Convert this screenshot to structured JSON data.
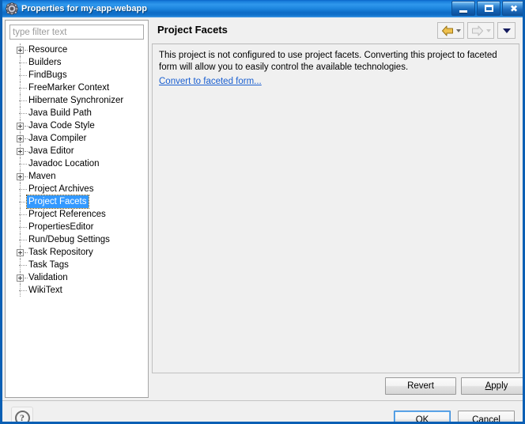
{
  "window": {
    "title": "Properties for my-app-webapp",
    "icon": "properties-gear-icon",
    "controls": {
      "minimize": "Minimize",
      "maximize": "Maximize",
      "close": "Close"
    }
  },
  "sidebar": {
    "filter": {
      "value": "",
      "placeholder": "type filter text"
    },
    "items": [
      {
        "label": "Resource",
        "expandable": true,
        "selected": false
      },
      {
        "label": "Builders",
        "expandable": false,
        "selected": false
      },
      {
        "label": "FindBugs",
        "expandable": false,
        "selected": false
      },
      {
        "label": "FreeMarker Context",
        "expandable": false,
        "selected": false
      },
      {
        "label": "Hibernate Synchronizer",
        "expandable": false,
        "selected": false
      },
      {
        "label": "Java Build Path",
        "expandable": false,
        "selected": false
      },
      {
        "label": "Java Code Style",
        "expandable": true,
        "selected": false
      },
      {
        "label": "Java Compiler",
        "expandable": true,
        "selected": false
      },
      {
        "label": "Java Editor",
        "expandable": true,
        "selected": false
      },
      {
        "label": "Javadoc Location",
        "expandable": false,
        "selected": false
      },
      {
        "label": "Maven",
        "expandable": true,
        "selected": false
      },
      {
        "label": "Project Archives",
        "expandable": false,
        "selected": false
      },
      {
        "label": "Project Facets",
        "expandable": false,
        "selected": true
      },
      {
        "label": "Project References",
        "expandable": false,
        "selected": false
      },
      {
        "label": "PropertiesEditor",
        "expandable": false,
        "selected": false
      },
      {
        "label": "Run/Debug Settings",
        "expandable": false,
        "selected": false
      },
      {
        "label": "Task Repository",
        "expandable": true,
        "selected": false
      },
      {
        "label": "Task Tags",
        "expandable": false,
        "selected": false
      },
      {
        "label": "Validation",
        "expandable": true,
        "selected": false
      },
      {
        "label": "WikiText",
        "expandable": false,
        "selected": false
      }
    ]
  },
  "page": {
    "title": "Project Facets",
    "body_text": "This project is not configured to use project facets. Converting this project to faceted form will allow you to easily control the available technologies.",
    "link_label": "Convert to faceted form...",
    "nav": {
      "back": "back-arrow-icon",
      "forward": "forward-arrow-icon",
      "menu": "dropdown-chevron-icon"
    }
  },
  "buttons": {
    "revert": "Revert",
    "apply_prefix": "A",
    "apply_rest": "pply",
    "ok": "OK",
    "cancel": "Cancel",
    "help": "?"
  },
  "colors": {
    "title_bar_blue": "#1a7fdc",
    "selection_blue": "#3399ff",
    "link_blue": "#1a5fd0",
    "back_arrow_gold": "#e8b23a",
    "forward_arrow_gray": "#d8d8d8",
    "dialog_gray": "#f0f0f0"
  }
}
